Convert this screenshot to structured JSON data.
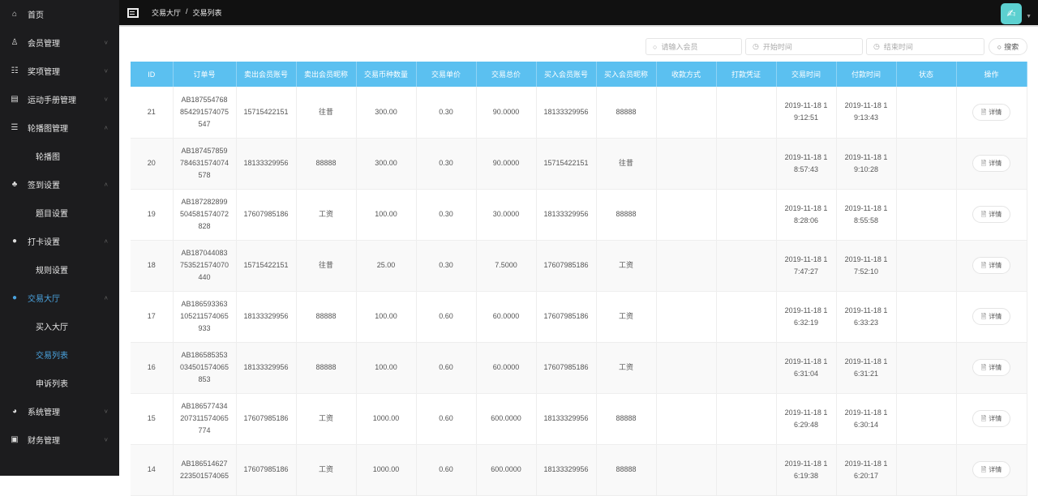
{
  "sidebar": {
    "items": [
      {
        "label": "首页",
        "icon": "home-icon",
        "chevron": ""
      },
      {
        "label": "会员管理",
        "icon": "member-icon",
        "chevron": "˅"
      },
      {
        "label": "奖项管理",
        "icon": "award-icon",
        "chevron": "˅"
      },
      {
        "label": "运动手册管理",
        "icon": "book-icon",
        "chevron": "˅"
      },
      {
        "label": "轮播图管理",
        "icon": "carousel-icon",
        "chevron": "˄",
        "children": [
          "轮播图"
        ]
      },
      {
        "label": "签到设置",
        "icon": "sitemap-icon",
        "chevron": "˄",
        "children": [
          "题目设置"
        ]
      },
      {
        "label": "打卡设置",
        "icon": "circle-icon",
        "chevron": "˄",
        "children": [
          "规则设置"
        ]
      },
      {
        "label": "交易大厅",
        "icon": "circle-icon",
        "chevron": "˄",
        "active": true,
        "children": [
          "买入大厅",
          "交易列表",
          "申诉列表"
        ]
      },
      {
        "label": "系统管理",
        "icon": "globe-icon",
        "chevron": "˅"
      },
      {
        "label": "财务管理",
        "icon": "finance-icon",
        "chevron": "˅"
      }
    ]
  },
  "topbar": {
    "breadcrumb": [
      "交易大厅",
      "/",
      "交易列表"
    ],
    "avatar_icon": "avatar-icon"
  },
  "filters": {
    "member_placeholder": "请输入会员",
    "start_placeholder": "开始时间",
    "end_placeholder": "结束时间",
    "search_label": "搜索"
  },
  "table": {
    "headers": [
      "ID",
      "订单号",
      "卖出会员账号",
      "卖出会员昵称",
      "交易币种数量",
      "交易单价",
      "交易总价",
      "买入会员账号",
      "买入会员昵称",
      "收款方式",
      "打款凭证",
      "交易时间",
      "付款时间",
      "状态",
      "操作"
    ],
    "detail_label": "详情",
    "rows": [
      [
        "21",
        "AB187554768854291574075547",
        "15715422151",
        "往昔",
        "300.00",
        "0.30",
        "90.0000",
        "18133329956",
        "88888",
        "",
        "",
        "2019-11-18 19:12:51",
        "2019-11-18 19:13:43",
        ""
      ],
      [
        "20",
        "AB187457859784631574074578",
        "18133329956",
        "88888",
        "300.00",
        "0.30",
        "90.0000",
        "15715422151",
        "往昔",
        "",
        "",
        "2019-11-18 18:57:43",
        "2019-11-18 19:10:28",
        ""
      ],
      [
        "19",
        "AB187282899504581574072828",
        "17607985186",
        "工资",
        "100.00",
        "0.30",
        "30.0000",
        "18133329956",
        "88888",
        "",
        "",
        "2019-11-18 18:28:06",
        "2019-11-18 18:55:58",
        ""
      ],
      [
        "18",
        "AB187044083753521574070440",
        "15715422151",
        "往昔",
        "25.00",
        "0.30",
        "7.5000",
        "17607985186",
        "工资",
        "",
        "",
        "2019-11-18 17:47:27",
        "2019-11-18 17:52:10",
        ""
      ],
      [
        "17",
        "AB186593363105211574065933",
        "18133329956",
        "88888",
        "100.00",
        "0.60",
        "60.0000",
        "17607985186",
        "工资",
        "",
        "",
        "2019-11-18 16:32:19",
        "2019-11-18 16:33:23",
        ""
      ],
      [
        "16",
        "AB186585353034501574065853",
        "18133329956",
        "88888",
        "100.00",
        "0.60",
        "60.0000",
        "17607985186",
        "工资",
        "",
        "",
        "2019-11-18 16:31:04",
        "2019-11-18 16:31:21",
        ""
      ],
      [
        "15",
        "AB186577434207311574065774",
        "17607985186",
        "工资",
        "1000.00",
        "0.60",
        "600.0000",
        "18133329956",
        "88888",
        "",
        "",
        "2019-11-18 16:29:48",
        "2019-11-18 16:30:14",
        ""
      ],
      [
        "14",
        "AB186514627223501574065",
        "17607985186",
        "工资",
        "1000.00",
        "0.60",
        "600.0000",
        "18133329956",
        "88888",
        "",
        "",
        "2019-11-18 16:19:38",
        "2019-11-18 16:20:17",
        ""
      ]
    ]
  },
  "colors": {
    "accent": "#5bc0f0",
    "active_nav": "#4aa3df",
    "sidebar_bg": "#1c1c1e"
  }
}
